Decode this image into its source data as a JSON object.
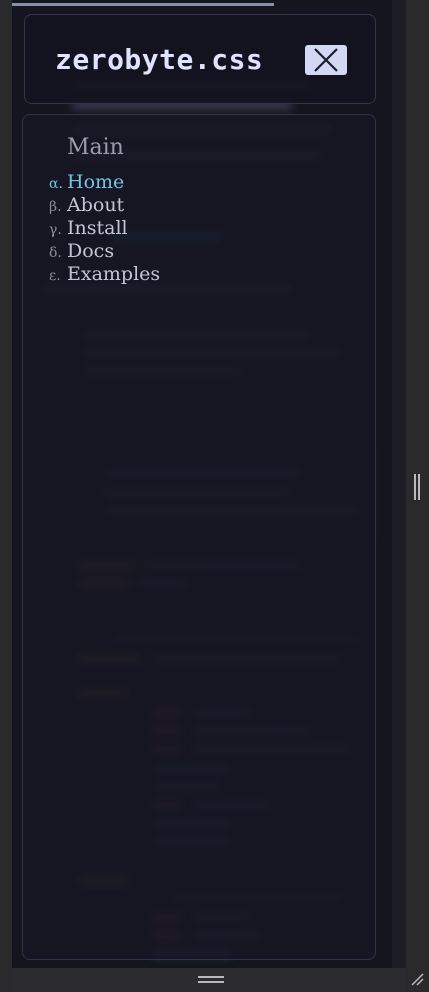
{
  "header": {
    "logo_text": "zerobyte.css",
    "close_label": "close menu"
  },
  "nav": {
    "title": "Main",
    "items": [
      {
        "marker": "α.",
        "label": "Home",
        "active": true
      },
      {
        "marker": "β.",
        "label": "About",
        "active": false
      },
      {
        "marker": "γ.",
        "label": "Install",
        "active": false
      },
      {
        "marker": "δ.",
        "label": "Docs",
        "active": false
      },
      {
        "marker": "ε.",
        "label": "Examples",
        "active": false
      }
    ]
  },
  "colors": {
    "accent": "#74c3e6",
    "background": "#15151f",
    "logo": "#dfe3ff"
  },
  "icons": [
    "close-icon",
    "vertical-resize-grip-icon",
    "horizontal-resize-grip-icon",
    "corner-resize-grip-icon"
  ]
}
